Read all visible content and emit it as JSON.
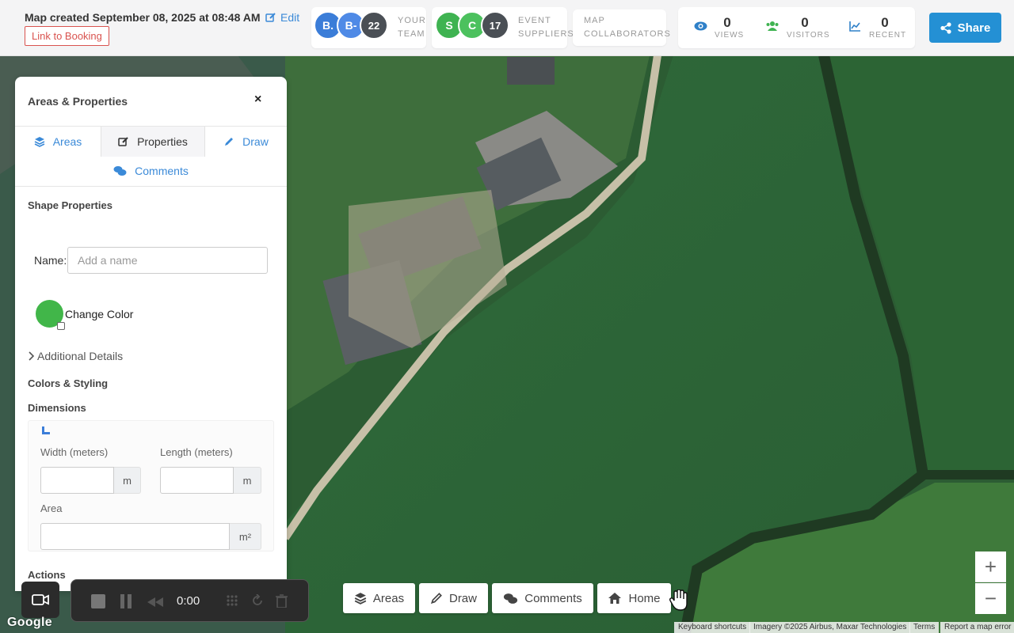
{
  "header": {
    "created_text": "Map created September 08, 2025 at 08:48 AM",
    "edit_label": "Edit",
    "booking_link": "Link to Booking"
  },
  "team": {
    "avatars": [
      {
        "label": "B.",
        "color": "#3b7dd8"
      },
      {
        "label": "B-",
        "color": "#4f8ae6"
      },
      {
        "label": "22",
        "color": "#4a4f55"
      }
    ],
    "label_line1": "YOUR",
    "label_line2": "TEAM"
  },
  "suppliers": {
    "avatars": [
      {
        "label": "S",
        "color": "#3fb351"
      },
      {
        "label": "C",
        "color": "#4cc15e"
      },
      {
        "label": "17",
        "color": "#4a4f55"
      }
    ],
    "label_line1": "EVENT",
    "label_line2": "SUPPLIERS"
  },
  "collaborators": {
    "label_line1": "MAP",
    "label_line2": "COLLABORATORS"
  },
  "stats": [
    {
      "value": "0",
      "label": "VIEWS",
      "icon": "eye-icon",
      "color": "#2f80c8"
    },
    {
      "value": "0",
      "label": "VISITORS",
      "icon": "users-icon",
      "color": "#3fb351"
    },
    {
      "value": "0",
      "label": "RECENT",
      "icon": "line-chart-icon",
      "color": "#2f80c8"
    }
  ],
  "share_label": "Share",
  "panel": {
    "title": "Areas & Properties",
    "close": "×",
    "tabs": {
      "areas": "Areas",
      "properties": "Properties",
      "draw": "Draw",
      "comments": "Comments"
    },
    "shape_properties": "Shape Properties",
    "name_label": "Name:",
    "name_placeholder": "Add a name",
    "name_value": "",
    "color": "#41b649",
    "change_color": "Change Color",
    "additional_details": "Additional Details",
    "colors_styling": "Colors & Styling",
    "dimensions": "Dimensions",
    "width_label": "Width (meters)",
    "width_unit": "m",
    "length_label": "Length (meters)",
    "length_unit": "m",
    "area_label": "Area",
    "area_unit": "m²",
    "actions": "Actions"
  },
  "recorder": {
    "time": "0:00"
  },
  "toolbar": {
    "areas": "Areas",
    "draw": "Draw",
    "comments": "Comments",
    "home": "Home"
  },
  "zoom": {
    "in": "+",
    "out": "−"
  },
  "map_footer": {
    "google": "Google",
    "shortcuts": "Keyboard shortcuts",
    "imagery": "Imagery ©2025 Airbus, Maxar Technologies",
    "terms": "Terms",
    "report": "Report a map error"
  }
}
